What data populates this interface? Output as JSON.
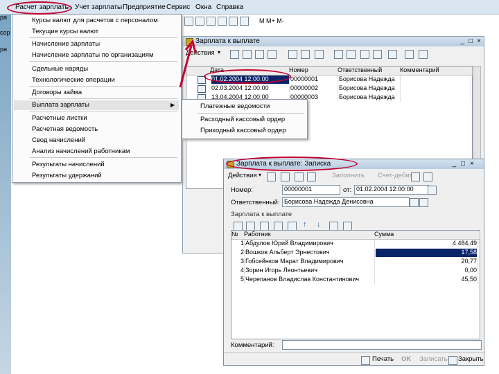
{
  "menubar": {
    "items": [
      "Расчет зарплаты",
      "Учет зарплаты",
      "Предприятие",
      "Сервис",
      "Окна",
      "Справка"
    ],
    "toolbar_label": "M M+ M-"
  },
  "sidebar": {
    "labels": [
      "ра",
      "сор",
      "ра"
    ]
  },
  "dropdown": {
    "items": [
      "Курсы валют для расчетов с персоналом",
      "Текущие курсы валют",
      "Начисление зарплаты",
      "Начисление зарплаты по организациям",
      "Сдельные наряды",
      "Технологические операции",
      "Договоры займа",
      "Выплата зарплаты",
      "Расчетные листки",
      "Расчетная ведомость",
      "Свод начислений",
      "Анализ начислений работникам",
      "Результаты начислений",
      "Результаты удержаний"
    ],
    "submenu_arrow": "▶"
  },
  "submenu": {
    "items": [
      "Платежные ведомости",
      "Расходный кассовый ордер",
      "Приходный кассовый ордер"
    ]
  },
  "list_window": {
    "title": "Зарплата к выплате",
    "actions_label": "Действия",
    "columns": [
      "Дата",
      "Номер",
      "Ответственный",
      "Комментарий"
    ],
    "rows": [
      {
        "date": "01.02.2004 12:00:00",
        "number": "00000001",
        "responsible": "Борисова Надежда",
        "comment": ""
      },
      {
        "date": "02.03.2004 12:00:00",
        "number": "00000002",
        "responsible": "Борисова Надежда",
        "comment": ""
      },
      {
        "date": "13.04.2004 12:00:00",
        "number": "00000003",
        "responsible": "Борисова Надежда",
        "comment": ""
      }
    ]
  },
  "doc_window": {
    "title": "Зарплата к выплате: Записка",
    "actions_label": "Действия",
    "fill_label": "Заполнить",
    "calc_label": "Счет-дебит",
    "number_label": "Номер:",
    "number_value": "00000001",
    "date_label": "от:",
    "date_value": "01.02.2004 12:00:00",
    "responsible_label": "Ответственный:",
    "responsible_value": "Борисова Надежда Денисовна",
    "section_label": "Зарплата к выплате",
    "table_columns": [
      "№",
      "Работник",
      "Сумма"
    ],
    "table_rows": [
      {
        "n": "1",
        "employee": "Абдулов Юрий Владимирович",
        "sum": "4 484,49"
      },
      {
        "n": "2",
        "employee": "Вошков Альберт Эрнестович",
        "sum": "17,58"
      },
      {
        "n": "3",
        "employee": "Гобсейнков Марат Владимирович",
        "sum": "20,77"
      },
      {
        "n": "4",
        "employee": "Зорин Игорь Леонтьевич",
        "sum": "0,00"
      },
      {
        "n": "5",
        "employee": "Черепанов Владислав Константинович",
        "sum": "45,50"
      }
    ],
    "comment_label": "Комментарий:",
    "comment_value": "",
    "print_label": "Печать",
    "ok_label": "OK",
    "save_label": "Записать",
    "close_label": "Закрыть"
  },
  "colors": {
    "accent": "#c3002f",
    "selection": "#0a246a",
    "titlebar": "#c6d8ea"
  }
}
